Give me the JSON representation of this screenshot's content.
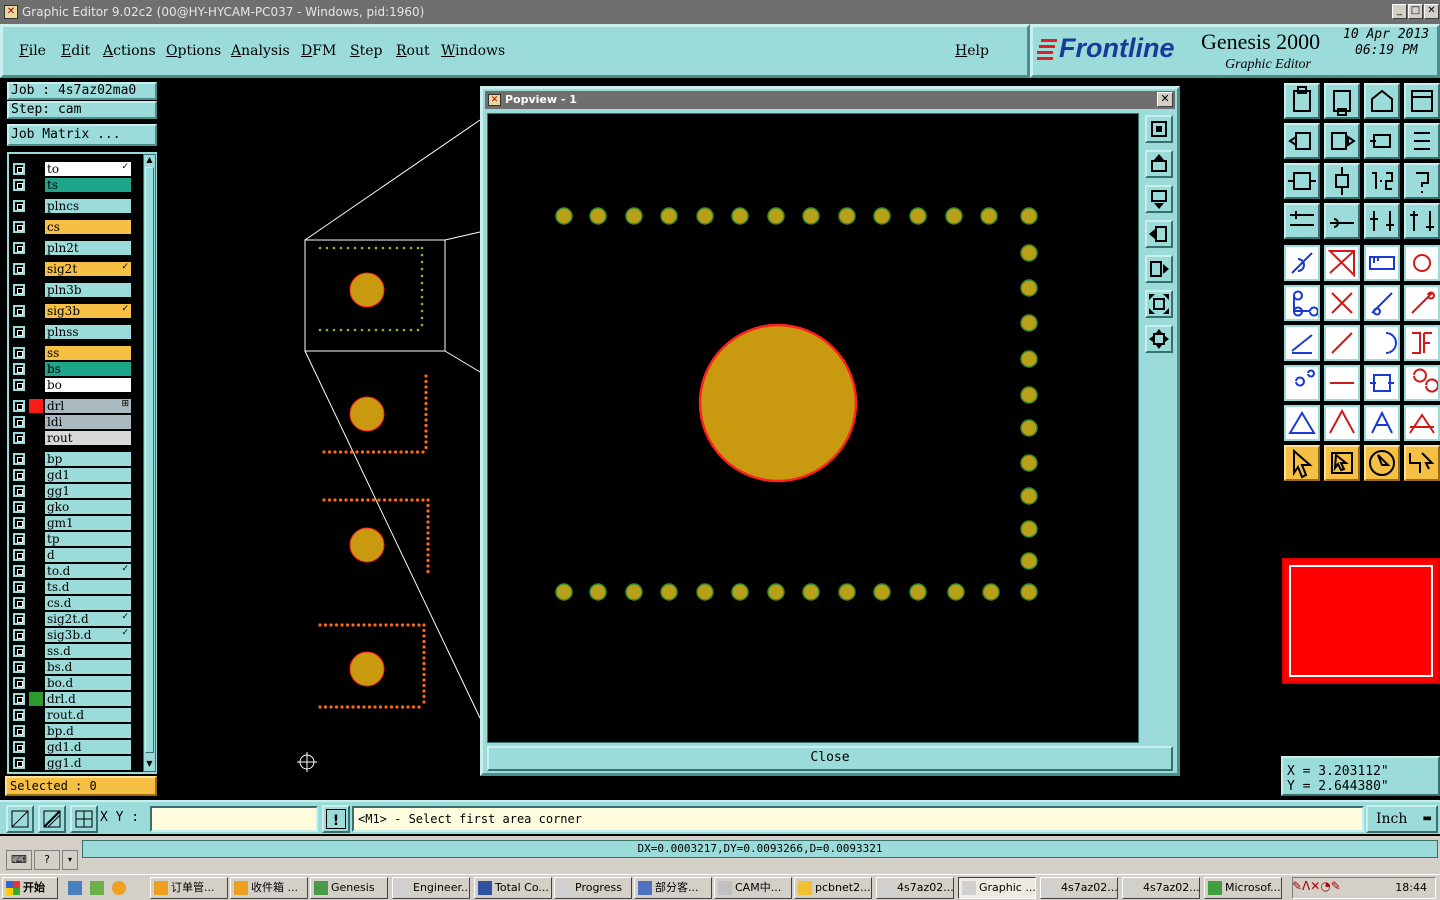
{
  "window": {
    "title": "Graphic Editor 9.02c2 (00@HY-HYCAM-PC037 - Windows, pid:1960)"
  },
  "menu": {
    "items": [
      "File",
      "Edit",
      "Actions",
      "Options",
      "Analysis",
      "DFM",
      "Step",
      "Rout",
      "Windows"
    ],
    "help": "Help"
  },
  "brand": {
    "logo": "Frontline",
    "product": "Genesis 2000",
    "subtitle": "Graphic Editor",
    "date": "10 Apr 2013",
    "time": "06:19 PM"
  },
  "job": {
    "job_line": "Job : 4s7az02ma0",
    "step_line": "Step: cam",
    "matrix_button": "Job Matrix ..."
  },
  "layers": [
    {
      "name": "to",
      "color": "#ffffff",
      "flag": "✓"
    },
    {
      "name": "ts",
      "color": "#1fa58a",
      "flag": ""
    },
    {
      "name": "plncs",
      "color": "#9bdcdb",
      "flag": ""
    },
    {
      "name": "cs",
      "color": "#f5c044",
      "flag": ""
    },
    {
      "name": "pln2t",
      "color": "#9bdcdb",
      "flag": ""
    },
    {
      "name": "sig2t",
      "color": "#f5c044",
      "flag": "✓"
    },
    {
      "name": "pln3b",
      "color": "#9bdcdb",
      "flag": ""
    },
    {
      "name": "sig3b",
      "color": "#f5c044",
      "flag": "✓"
    },
    {
      "name": "plnss",
      "color": "#9bdcdb",
      "flag": ""
    },
    {
      "name": "ss",
      "color": "#f5c044",
      "flag": ""
    },
    {
      "name": "bs",
      "color": "#1fa58a",
      "flag": ""
    },
    {
      "name": "bo",
      "color": "#ffffff",
      "flag": ""
    },
    {
      "name": "drl",
      "color": "#a9b9c0",
      "flag": "⊞",
      "active_color": "#ff1a1a"
    },
    {
      "name": "ldi",
      "color": "#a9b9c0",
      "flag": ""
    },
    {
      "name": "rout",
      "color": "#d8d8d8",
      "flag": ""
    },
    {
      "name": "bp",
      "color": "#9bdcdb",
      "flag": ""
    },
    {
      "name": "gd1",
      "color": "#9bdcdb",
      "flag": ""
    },
    {
      "name": "gg1",
      "color": "#9bdcdb",
      "flag": ""
    },
    {
      "name": "gko",
      "color": "#9bdcdb",
      "flag": ""
    },
    {
      "name": "gm1",
      "color": "#9bdcdb",
      "flag": ""
    },
    {
      "name": "tp",
      "color": "#9bdcdb",
      "flag": ""
    },
    {
      "name": "d",
      "color": "#9bdcdb",
      "flag": ""
    },
    {
      "name": "to.d",
      "color": "#9bdcdb",
      "flag": "✓"
    },
    {
      "name": "ts.d",
      "color": "#9bdcdb",
      "flag": ""
    },
    {
      "name": "cs.d",
      "color": "#9bdcdb",
      "flag": ""
    },
    {
      "name": "sig2t.d",
      "color": "#9bdcdb",
      "flag": "✓"
    },
    {
      "name": "sig3b.d",
      "color": "#9bdcdb",
      "flag": "✓"
    },
    {
      "name": "ss.d",
      "color": "#9bdcdb",
      "flag": ""
    },
    {
      "name": "bs.d",
      "color": "#9bdcdb",
      "flag": ""
    },
    {
      "name": "bo.d",
      "color": "#9bdcdb",
      "flag": ""
    },
    {
      "name": "drl.d",
      "color": "#9bdcdb",
      "flag": "",
      "active_color": "#2e9a2e"
    },
    {
      "name": "rout.d",
      "color": "#9bdcdb",
      "flag": ""
    },
    {
      "name": "bp.d",
      "color": "#9bdcdb",
      "flag": ""
    },
    {
      "name": "gd1.d",
      "color": "#9bdcdb",
      "flag": ""
    },
    {
      "name": "gg1.d",
      "color": "#9bdcdb",
      "flag": ""
    }
  ],
  "selected": "Selected : 0",
  "popview": {
    "title": "Popview - 1",
    "close_label": "Close"
  },
  "coords": {
    "x": "X = 3.203112\"",
    "y": "Y = 2.644380\""
  },
  "input": {
    "xy_label": "X Y :",
    "xy_value": "",
    "prompt": "<M1> - Select first area corner",
    "units": "Inch"
  },
  "measure": "DX=0.0003217,DY=0.0093266,D=0.0093321",
  "colors": {
    "teal": "#9bdcdb",
    "pad": "#c99a10",
    "pad_outline": "#ff2020",
    "dot": "#b8a018",
    "accent_red": "#ff0000"
  },
  "taskbar": {
    "start": "开始",
    "tasks": [
      "订单管...",
      "收件箱 ...",
      "Genesis",
      "Engineer...",
      "Total Co...",
      "Progress",
      "部分客...",
      "CAM中...",
      "pcbnet2...",
      "4s7az02...",
      "Graphic ...",
      "4s7az02...",
      "4s7az02...",
      "Microsof..."
    ],
    "clock": "18:44"
  }
}
